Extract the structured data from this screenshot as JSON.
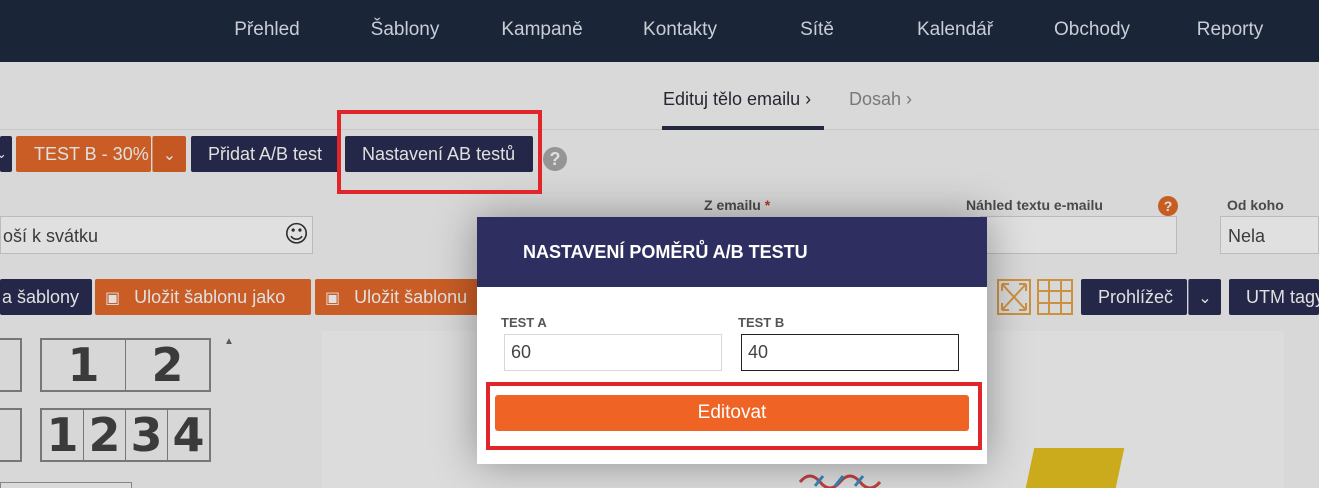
{
  "nav": {
    "items": [
      "Přehled",
      "Šablony",
      "Kampaně",
      "Kontakty",
      "Sítě",
      "Kalendář",
      "Obchody",
      "Reporty"
    ]
  },
  "tabs": {
    "active": "Edituj tělo emailu",
    "next": "Dosah"
  },
  "ab_bar": {
    "test_b_label": "TEST B - 30%",
    "add_ab": "Přidat A/B test",
    "ab_settings": "Nastavení AB testů"
  },
  "fields": {
    "subject_value": "oší k svátku",
    "from_email_label": "Z emailu",
    "required_mark": "*",
    "preview_label": "Náhled textu e-mailu",
    "from_who_label": "Od koho",
    "from_who_value": "Nela"
  },
  "toolbar": {
    "templates_partial": "a šablony",
    "save_as": "Uložit šablonu jako",
    "save": "Uložit šablonu",
    "browser": "Prohlížeč",
    "utm": "UTM tagy"
  },
  "layouts": {
    "row1": [
      "1",
      "2"
    ],
    "row2": [
      "1",
      "2",
      "3",
      "4"
    ]
  },
  "modal": {
    "title": "NASTAVENÍ POMĚRŮ A/B TESTU",
    "test_a_label": "TEST A",
    "test_a_value": "60",
    "test_b_label": "TEST B",
    "test_b_value": "40",
    "submit": "Editovat"
  },
  "colors": {
    "nav_bg": "#1a2538",
    "navy_button": "#2b2d52",
    "orange_button": "#e66a2c",
    "modal_header": "#2e2e61",
    "highlight": "#e0252b"
  }
}
